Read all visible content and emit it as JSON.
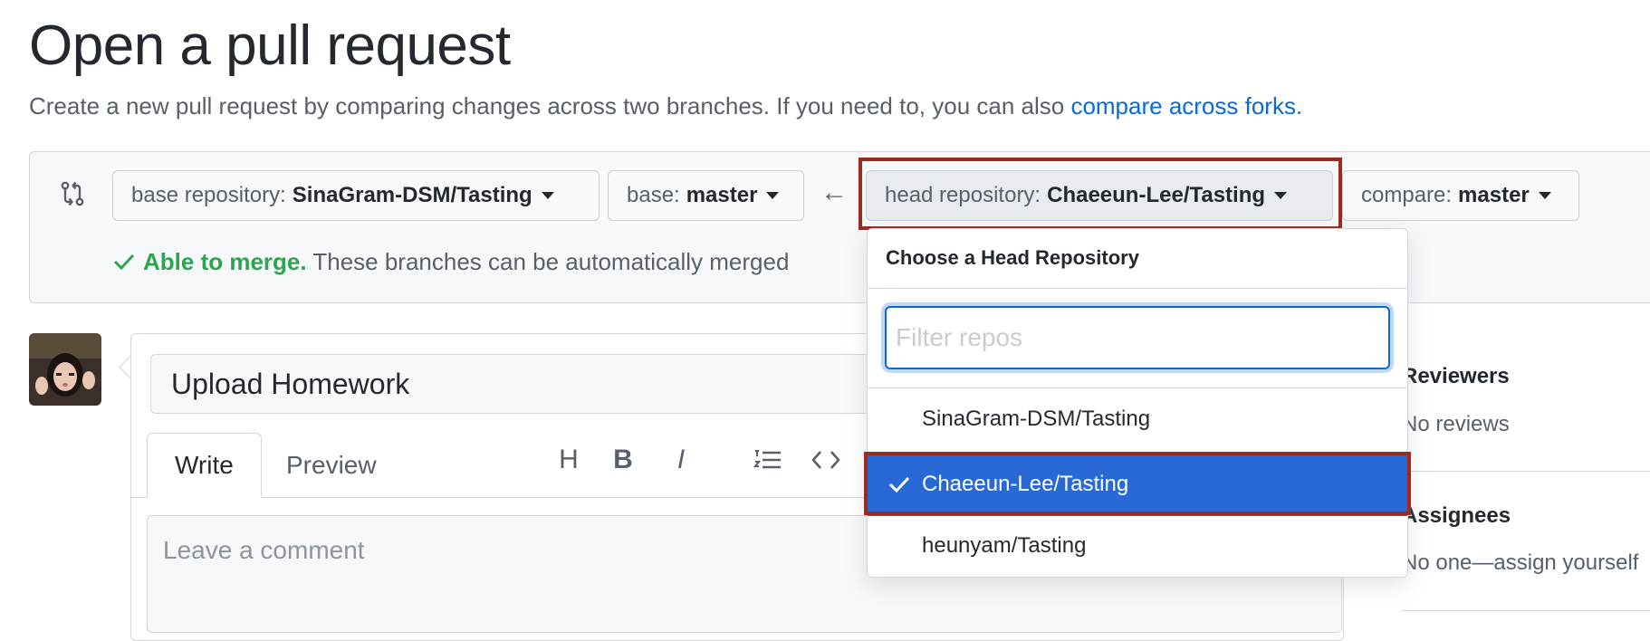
{
  "page": {
    "title": "Open a pull request",
    "subtitle": "Create a new pull request by comparing changes across two branches. If you need to, you can also ",
    "subtitle_link": "compare across forks."
  },
  "compare": {
    "base_repo_label": "base repository:",
    "base_repo_value": "SinaGram-DSM/Tasting",
    "base_label": "base:",
    "base_value": "master",
    "head_repo_label": "head repository:",
    "head_repo_value": "Chaeeun-Lee/Tasting",
    "compare_label": "compare:",
    "compare_value": "master",
    "merge_ok": "Able to merge.",
    "merge_rest": " These branches can be automatically merged"
  },
  "dropdown": {
    "header": "Choose a Head Repository",
    "filter_placeholder": "Filter repos",
    "items": [
      {
        "label": "SinaGram-DSM/Tasting",
        "selected": false
      },
      {
        "label": "Chaeeun-Lee/Tasting",
        "selected": true
      },
      {
        "label": "heunyam/Tasting",
        "selected": false
      }
    ]
  },
  "form": {
    "title_value": "Upload Homework",
    "tab_write": "Write",
    "tab_preview": "Preview",
    "toolbar_icons": [
      "heading-icon",
      "bold-icon",
      "italic-icon",
      "ordered-list-icon",
      "code-icon"
    ],
    "toolbar_glyphs": {
      "heading": "H",
      "bold": "B",
      "italic": "I"
    },
    "comment_placeholder": "Leave a comment"
  },
  "sidebar": {
    "reviewers_title": "Reviewers",
    "reviewers_value": "No reviews",
    "assignees_title": "Assignees",
    "assignees_value": "No one—assign yourself"
  },
  "colors": {
    "link": "#0969da",
    "merge_ok": "#2da44e",
    "selected_item": "#2969d6",
    "highlight": "#9b2a1f"
  }
}
